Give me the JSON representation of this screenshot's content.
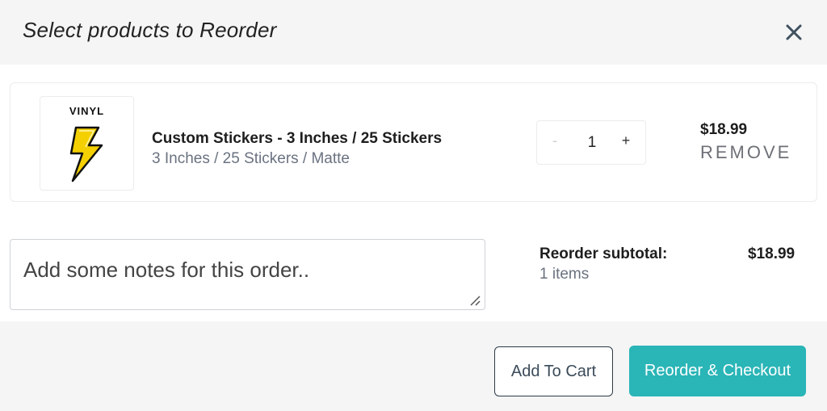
{
  "dialog": {
    "title": "Select products to Reorder",
    "close_icon": "close-icon"
  },
  "product": {
    "thumbnail_label": "VINYL",
    "thumbnail_icon": "lightning-bolt-icon",
    "name": "Custom Stickers - 3 Inches / 25 Stickers",
    "variant": "3 Inches / 25 Stickers / Matte",
    "quantity": "1",
    "minus_label": "-",
    "plus_label": "+",
    "price": "$18.99",
    "remove_label": "REMOVE"
  },
  "notes": {
    "placeholder": "Add some notes for this order.."
  },
  "summary": {
    "subtotal_label": "Reorder subtotal:",
    "item_count": "1 items",
    "subtotal_value": "$18.99"
  },
  "actions": {
    "add_to_cart": "Add To Cart",
    "reorder_checkout": "Reorder & Checkout"
  },
  "colors": {
    "accent": "#2ab5b7",
    "header_bg": "#f5f5f5",
    "bolt_yellow": "#f5d000"
  }
}
